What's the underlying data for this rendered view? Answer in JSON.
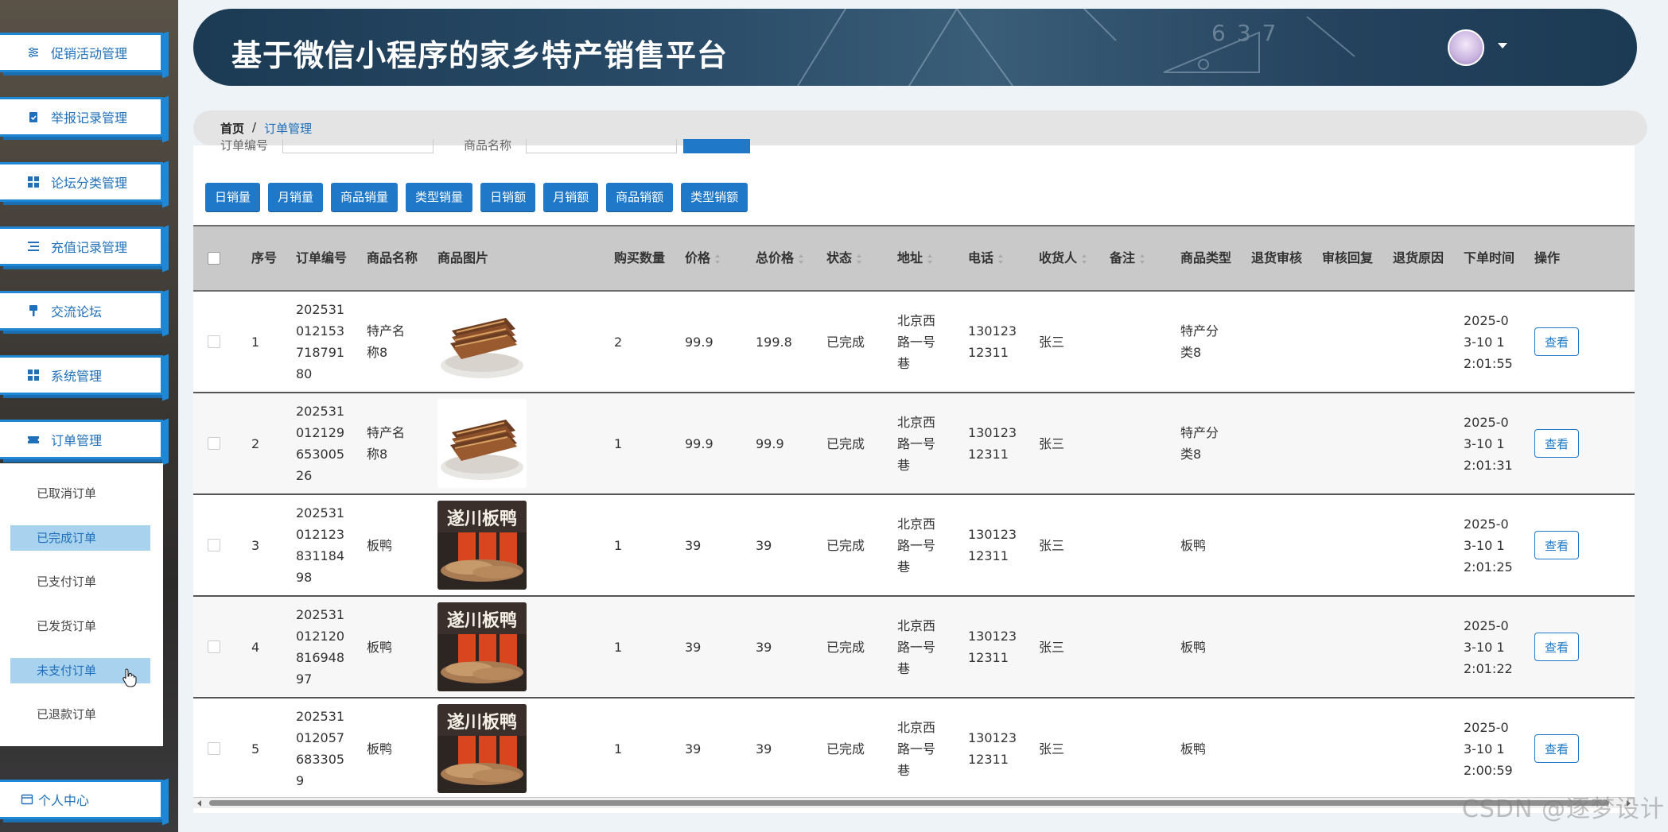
{
  "header": {
    "title": "基于微信小程序的家乡特产销售平台",
    "board_digits": "637"
  },
  "sidebar": {
    "items": [
      {
        "label": "促销活动管理",
        "icon": "sliders-icon"
      },
      {
        "label": "举报记录管理",
        "icon": "clipboard-icon"
      },
      {
        "label": "论坛分类管理",
        "icon": "grid-icon"
      },
      {
        "label": "充值记录管理",
        "icon": "list-icon"
      },
      {
        "label": "交流论坛",
        "icon": "brush-icon"
      },
      {
        "label": "系统管理",
        "icon": "grid-icon"
      },
      {
        "label": "订单管理",
        "icon": "ticket-icon"
      }
    ],
    "sub_items": [
      {
        "label": "已取消订单",
        "active": false
      },
      {
        "label": "已完成订单",
        "active": true
      },
      {
        "label": "已支付订单",
        "active": false
      },
      {
        "label": "已发货订单",
        "active": false
      },
      {
        "label": "未支付订单",
        "active": true
      },
      {
        "label": "已退款订单",
        "active": false
      }
    ],
    "personal": {
      "label": "个人中心",
      "icon": "card-icon"
    }
  },
  "breadcrumb": {
    "home": "首页",
    "sep": "/",
    "current": "订单管理"
  },
  "search": {
    "order_no_label": "订单编号",
    "product_name_label": "商品名称"
  },
  "stat_buttons": [
    "日销量",
    "月销量",
    "商品销量",
    "类型销量",
    "日销额",
    "月销额",
    "商品销额",
    "类型销额"
  ],
  "table": {
    "columns": [
      "序号",
      "订单编号",
      "商品名称",
      "商品图片",
      "购买数量",
      "价格",
      "总价格",
      "状态",
      "地址",
      "电话",
      "收货人",
      "备注",
      "商品类型",
      "退货审核",
      "审核回复",
      "退货原因",
      "下单时间",
      "操作"
    ],
    "rows": [
      {
        "index": "1",
        "order_no": "20253101215371879180",
        "name": "特产名称8",
        "img": "tofu",
        "qty": "2",
        "price": "99.9",
        "total": "199.8",
        "status": "已完成",
        "address": "北京西路一号巷",
        "phone": "13012312311",
        "receiver": "张三",
        "note": "",
        "type": "特产分类8",
        "return_audit": "",
        "audit_reply": "",
        "return_reason": "",
        "time": "2025-03-10 12:01:55",
        "action": "查看"
      },
      {
        "index": "2",
        "order_no": "20253101212965300526",
        "name": "特产名称8",
        "img": "tofu",
        "qty": "1",
        "price": "99.9",
        "total": "99.9",
        "status": "已完成",
        "address": "北京西路一号巷",
        "phone": "13012312311",
        "receiver": "张三",
        "note": "",
        "type": "特产分类8",
        "return_audit": "",
        "audit_reply": "",
        "return_reason": "",
        "time": "2025-03-10 12:01:31",
        "action": "查看"
      },
      {
        "index": "3",
        "order_no": "20253101212383118498",
        "name": "板鸭",
        "img": "duck",
        "qty": "1",
        "price": "39",
        "total": "39",
        "status": "已完成",
        "address": "北京西路一号巷",
        "phone": "13012312311",
        "receiver": "张三",
        "note": "",
        "type": "板鸭",
        "return_audit": "",
        "audit_reply": "",
        "return_reason": "",
        "time": "2025-03-10 12:01:25",
        "action": "查看"
      },
      {
        "index": "4",
        "order_no": "20253101212081694897",
        "name": "板鸭",
        "img": "duck",
        "qty": "1",
        "price": "39",
        "total": "39",
        "status": "已完成",
        "address": "北京西路一号巷",
        "phone": "13012312311",
        "receiver": "张三",
        "note": "",
        "type": "板鸭",
        "return_audit": "",
        "audit_reply": "",
        "return_reason": "",
        "time": "2025-03-10 12:01:22",
        "action": "查看"
      },
      {
        "index": "5",
        "order_no": "2025310120576833059",
        "name": "板鸭",
        "img": "duck",
        "qty": "1",
        "price": "39",
        "total": "39",
        "status": "已完成",
        "address": "北京西路一号巷",
        "phone": "13012312311",
        "receiver": "张三",
        "note": "",
        "type": "板鸭",
        "return_audit": "",
        "audit_reply": "",
        "return_reason": "",
        "time": "2025-03-10 12:00:59",
        "action": "查看"
      }
    ]
  },
  "duck_img_text": "遂川板鸭",
  "watermark": "CSDN @逐梦设计"
}
